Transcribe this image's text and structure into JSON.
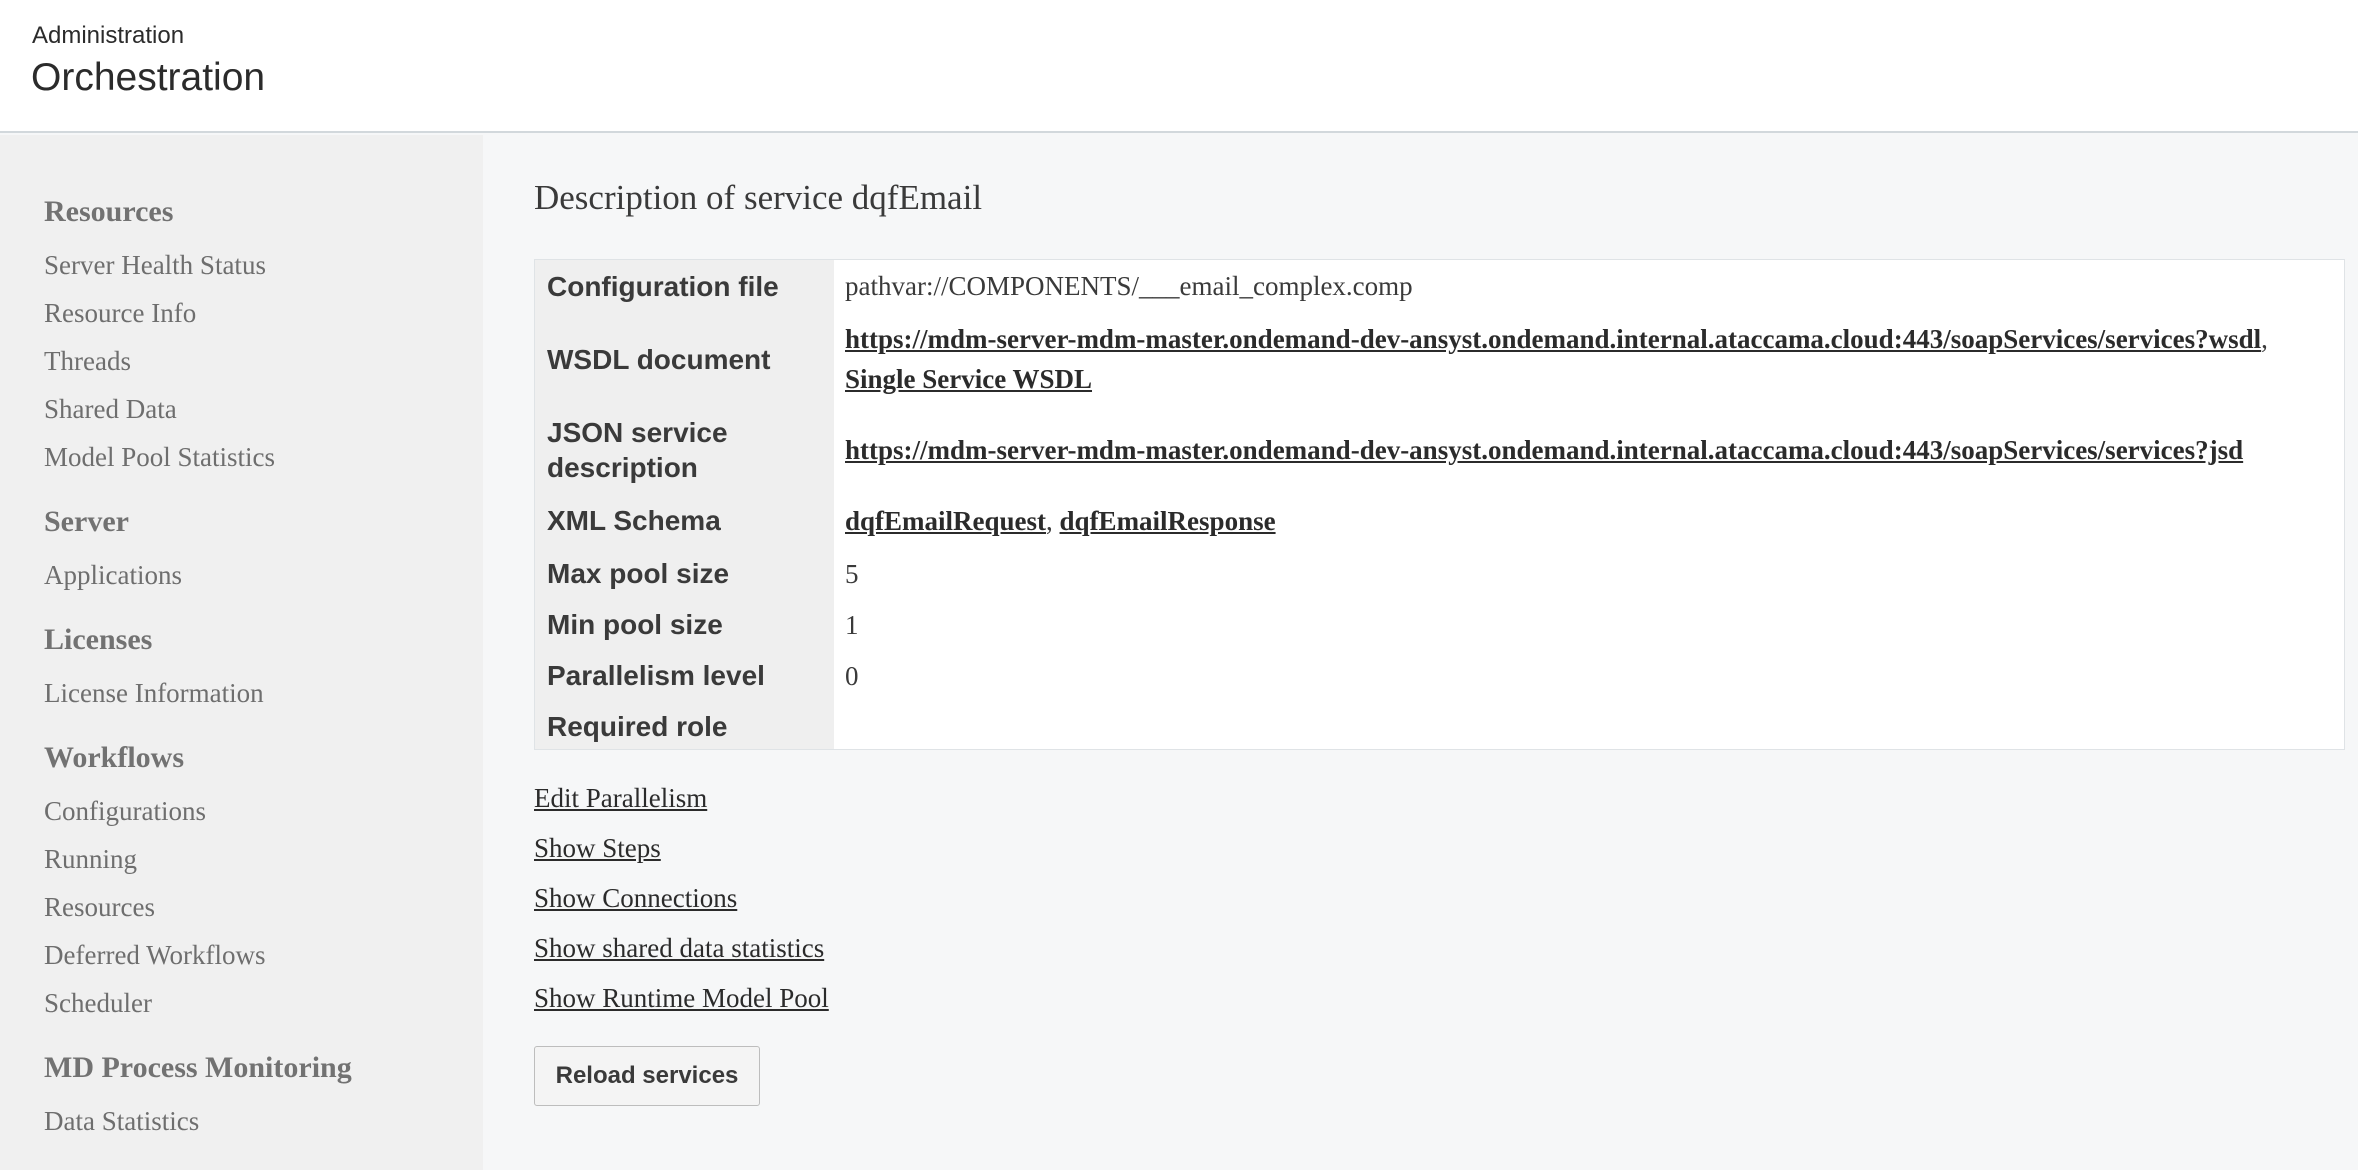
{
  "header": {
    "subtitle": "Administration",
    "title": "Orchestration"
  },
  "sidebar": {
    "sections": [
      {
        "heading": "Resources",
        "items": [
          "Server Health Status",
          "Resource Info",
          "Threads",
          "Shared Data",
          "Model Pool Statistics"
        ]
      },
      {
        "heading": "Server",
        "items": [
          "Applications"
        ]
      },
      {
        "heading": "Licenses",
        "items": [
          "License Information"
        ]
      },
      {
        "heading": "Workflows",
        "items": [
          "Configurations",
          "Running",
          "Resources",
          "Deferred Workflows",
          "Scheduler"
        ]
      },
      {
        "heading": "MD Process Monitoring",
        "items": [
          "Data Statistics"
        ]
      }
    ]
  },
  "main": {
    "title": "Description of service dqfEmail",
    "table": {
      "config_file": {
        "label": "Configuration file",
        "value": "pathvar://COMPONENTS/___email_complex.comp"
      },
      "wsdl": {
        "label": "WSDL document",
        "link1": "https://mdm-server-mdm-master.ondemand-dev-ansyst.ondemand.internal.ataccama.cloud:443/soapServices/services?wsdl",
        "separator": ",",
        "link2": "Single Service WSDL"
      },
      "json": {
        "label_line1": "JSON service",
        "label_line2": "description",
        "link": "https://mdm-server-mdm-master.ondemand-dev-ansyst.ondemand.internal.ataccama.cloud:443/soapServices/services?jsd"
      },
      "xml_schema": {
        "label": "XML Schema",
        "link1": "dqfEmailRequest",
        "separator": ",",
        "link2": "dqfEmailResponse"
      },
      "max_pool": {
        "label": "Max pool size",
        "value": "5"
      },
      "min_pool": {
        "label": "Min pool size",
        "value": "1"
      },
      "parallelism": {
        "label": "Parallelism level",
        "value": "0"
      },
      "required_role": {
        "label": "Required role",
        "value": ""
      }
    },
    "actions": {
      "edit_parallelism": "Edit Parallelism",
      "show_steps": "Show Steps",
      "show_connections": "Show Connections",
      "show_shared_data": "Show shared data statistics",
      "show_runtime_pool": "Show Runtime Model Pool"
    },
    "reload_button": "Reload services"
  }
}
